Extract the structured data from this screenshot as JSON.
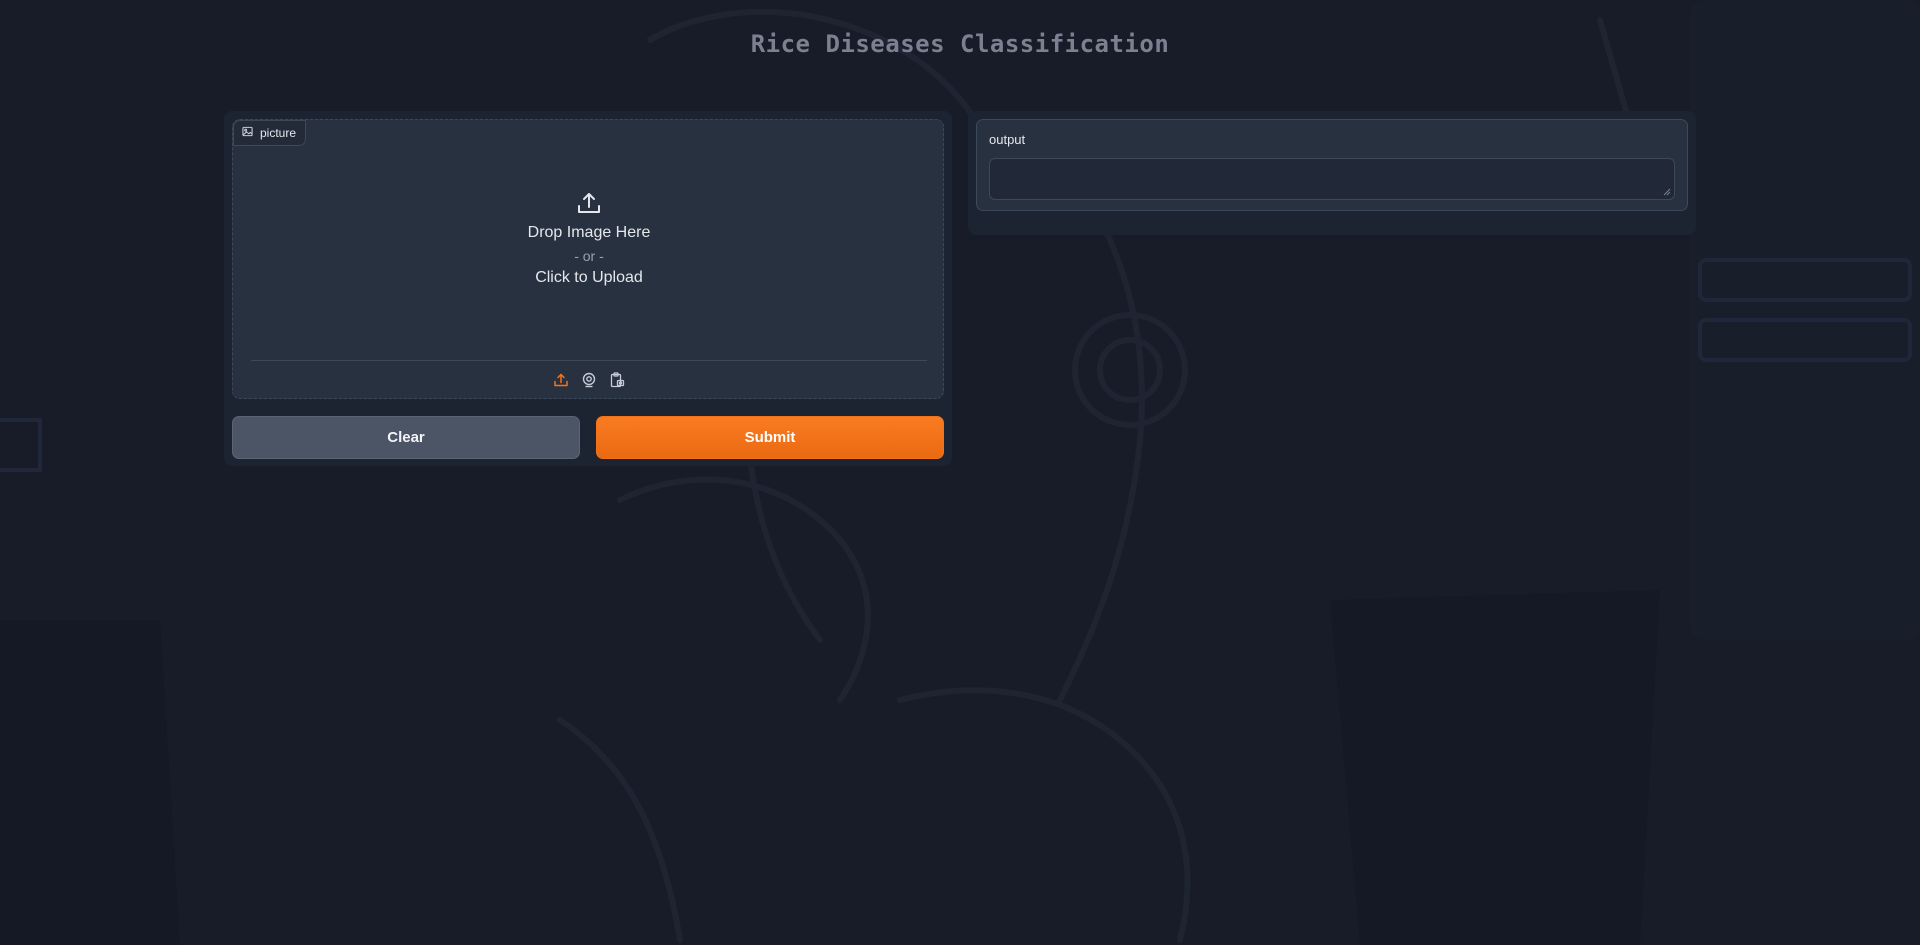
{
  "app": {
    "title": "Rice Diseases Classification"
  },
  "input": {
    "label": "picture",
    "label_icon": "image-icon",
    "drop_text": "Drop Image Here",
    "or_text": "- or -",
    "click_text": "Click to Upload",
    "sources": [
      {
        "name": "upload",
        "icon": "upload-icon",
        "active": true
      },
      {
        "name": "webcam",
        "icon": "webcam-icon",
        "active": false
      },
      {
        "name": "clipboard",
        "icon": "clipboard-icon",
        "active": false
      }
    ]
  },
  "actions": {
    "clear_label": "Clear",
    "submit_label": "Submit"
  },
  "output": {
    "label": "output",
    "value": ""
  },
  "colors": {
    "accent": "#f97316",
    "background": "#171c28",
    "panel": "#1c2331",
    "box": "#273140"
  }
}
